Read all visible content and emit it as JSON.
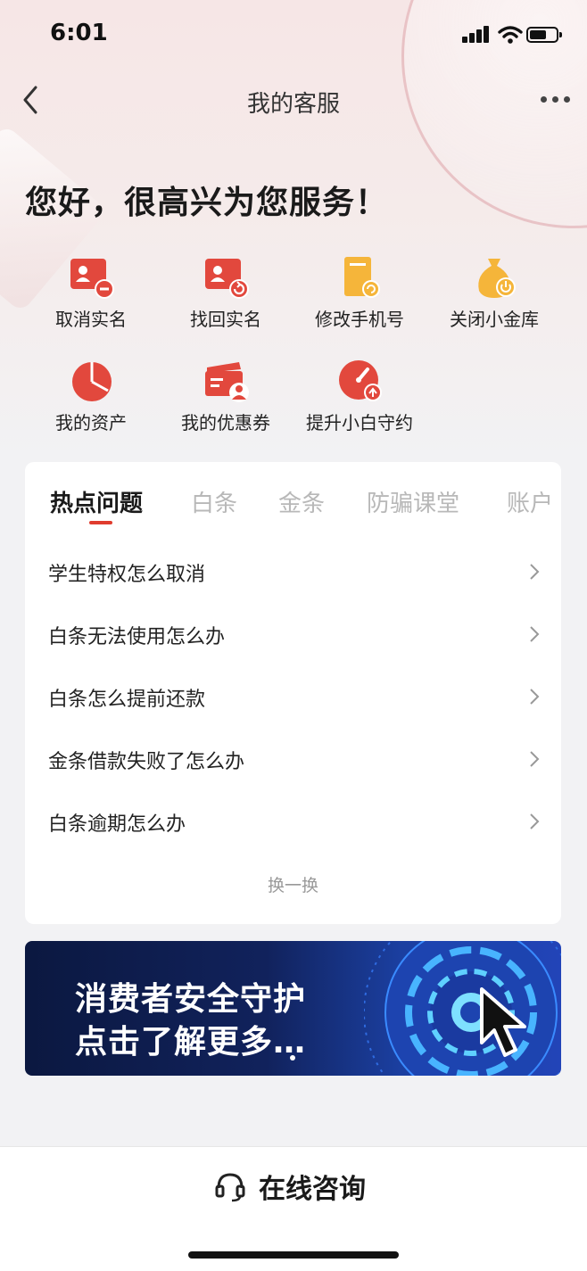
{
  "status_bar": {
    "time": "6:01"
  },
  "nav": {
    "title": "我的客服"
  },
  "greeting": "您好，很高兴为您服务！",
  "shortcuts": [
    {
      "label": "取消实名",
      "icon": "id-card-remove-icon",
      "color": "#e2483d"
    },
    {
      "label": "找回实名",
      "icon": "id-card-recover-icon",
      "color": "#e2483d"
    },
    {
      "label": "修改手机号",
      "icon": "phone-edit-icon",
      "color": "#f5b53a"
    },
    {
      "label": "关闭小金库",
      "icon": "money-bag-power-icon",
      "color": "#f5b53a"
    },
    {
      "label": "我的资产",
      "icon": "pie-chart-icon",
      "color": "#e2483d"
    },
    {
      "label": "我的优惠券",
      "icon": "coupon-user-icon",
      "color": "#e2483d"
    },
    {
      "label": "提升小白守约",
      "icon": "gauge-up-icon",
      "color": "#e2483d"
    }
  ],
  "tabs": [
    "热点问题",
    "白条",
    "金条",
    "防骗课堂",
    "账户"
  ],
  "active_tab": 0,
  "questions": [
    "学生特权怎么取消",
    "白条无法使用怎么办",
    "白条怎么提前还款",
    "金条借款失败了怎么办",
    "白条逾期怎么办"
  ],
  "refresh_label": "换一换",
  "banner": {
    "line1": "消费者安全守护",
    "line2": "点击了解更多…"
  },
  "bottom": {
    "consult_label": "在线咨询"
  },
  "colors": {
    "accent": "#e03c2e",
    "gold": "#f5b53a",
    "banner_bg": "#11225c"
  }
}
